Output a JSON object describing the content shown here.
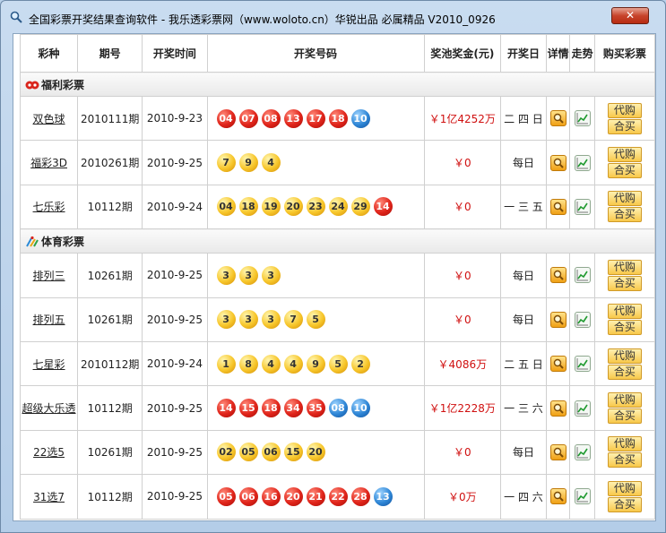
{
  "window": {
    "title": "全国彩票开奖结果查询软件 - 我乐透彩票网（www.woloto.cn）华锐出品 必属精品  V2010_0926"
  },
  "table": {
    "headers": {
      "type": "彩种",
      "issue": "期号",
      "time": "开奖时间",
      "numbers": "开奖号码",
      "pool": "奖池奖金(元)",
      "day": "开奖日",
      "detail": "详情",
      "trend": "走势",
      "buy": "购买彩票"
    },
    "buy_labels": {
      "proxy": "代购",
      "group": "合买"
    },
    "sections": [
      {
        "title": "福利彩票",
        "rows": [
          {
            "name": "双色球",
            "issue": "2010111期",
            "time": "2010-9-23",
            "balls": [
              [
                "04",
                "red"
              ],
              [
                "07",
                "red"
              ],
              [
                "08",
                "red"
              ],
              [
                "13",
                "red"
              ],
              [
                "17",
                "red"
              ],
              [
                "18",
                "red"
              ],
              [
                "10",
                "blue"
              ]
            ],
            "pool": "￥1亿4252万",
            "day": "二 四 日"
          },
          {
            "name": "福彩3D",
            "issue": "2010261期",
            "time": "2010-9-25",
            "balls": [
              [
                "7",
                "yellow"
              ],
              [
                "9",
                "yellow"
              ],
              [
                "4",
                "yellow"
              ]
            ],
            "pool": "￥0",
            "day": "每日"
          },
          {
            "name": "七乐彩",
            "issue": "10112期",
            "time": "2010-9-24",
            "balls": [
              [
                "04",
                "yellow"
              ],
              [
                "18",
                "yellow"
              ],
              [
                "19",
                "yellow"
              ],
              [
                "20",
                "yellow"
              ],
              [
                "23",
                "yellow"
              ],
              [
                "24",
                "yellow"
              ],
              [
                "29",
                "yellow"
              ],
              [
                "14",
                "red"
              ]
            ],
            "pool": "￥0",
            "day": "一 三 五"
          }
        ]
      },
      {
        "title": "体育彩票",
        "rows": [
          {
            "name": "排列三",
            "issue": "10261期",
            "time": "2010-9-25",
            "balls": [
              [
                "3",
                "yellow"
              ],
              [
                "3",
                "yellow"
              ],
              [
                "3",
                "yellow"
              ]
            ],
            "pool": "￥0",
            "day": "每日"
          },
          {
            "name": "排列五",
            "issue": "10261期",
            "time": "2010-9-25",
            "balls": [
              [
                "3",
                "yellow"
              ],
              [
                "3",
                "yellow"
              ],
              [
                "3",
                "yellow"
              ],
              [
                "7",
                "yellow"
              ],
              [
                "5",
                "yellow"
              ]
            ],
            "pool": "￥0",
            "day": "每日"
          },
          {
            "name": "七星彩",
            "issue": "2010112期",
            "time": "2010-9-24",
            "balls": [
              [
                "1",
                "yellow"
              ],
              [
                "8",
                "yellow"
              ],
              [
                "4",
                "yellow"
              ],
              [
                "4",
                "yellow"
              ],
              [
                "9",
                "yellow"
              ],
              [
                "5",
                "yellow"
              ],
              [
                "2",
                "yellow"
              ]
            ],
            "pool": "￥4086万",
            "day": "二 五 日"
          },
          {
            "name": "超级大乐透",
            "issue": "10112期",
            "time": "2010-9-25",
            "balls": [
              [
                "14",
                "red"
              ],
              [
                "15",
                "red"
              ],
              [
                "18",
                "red"
              ],
              [
                "34",
                "red"
              ],
              [
                "35",
                "red"
              ],
              [
                "08",
                "blue"
              ],
              [
                "10",
                "blue"
              ]
            ],
            "pool": "￥1亿2228万",
            "day": "一 三 六"
          },
          {
            "name": "22选5",
            "issue": "10261期",
            "time": "2010-9-25",
            "balls": [
              [
                "02",
                "yellow"
              ],
              [
                "05",
                "yellow"
              ],
              [
                "06",
                "yellow"
              ],
              [
                "15",
                "yellow"
              ],
              [
                "20",
                "yellow"
              ]
            ],
            "pool": "￥0",
            "day": "每日"
          },
          {
            "name": "31选7",
            "issue": "10112期",
            "time": "2010-9-25",
            "balls": [
              [
                "05",
                "red"
              ],
              [
                "06",
                "red"
              ],
              [
                "16",
                "red"
              ],
              [
                "20",
                "red"
              ],
              [
                "21",
                "red"
              ],
              [
                "22",
                "red"
              ],
              [
                "28",
                "red"
              ],
              [
                "13",
                "blue"
              ]
            ],
            "pool": "￥0万",
            "day": "一 四 六"
          }
        ]
      }
    ]
  }
}
